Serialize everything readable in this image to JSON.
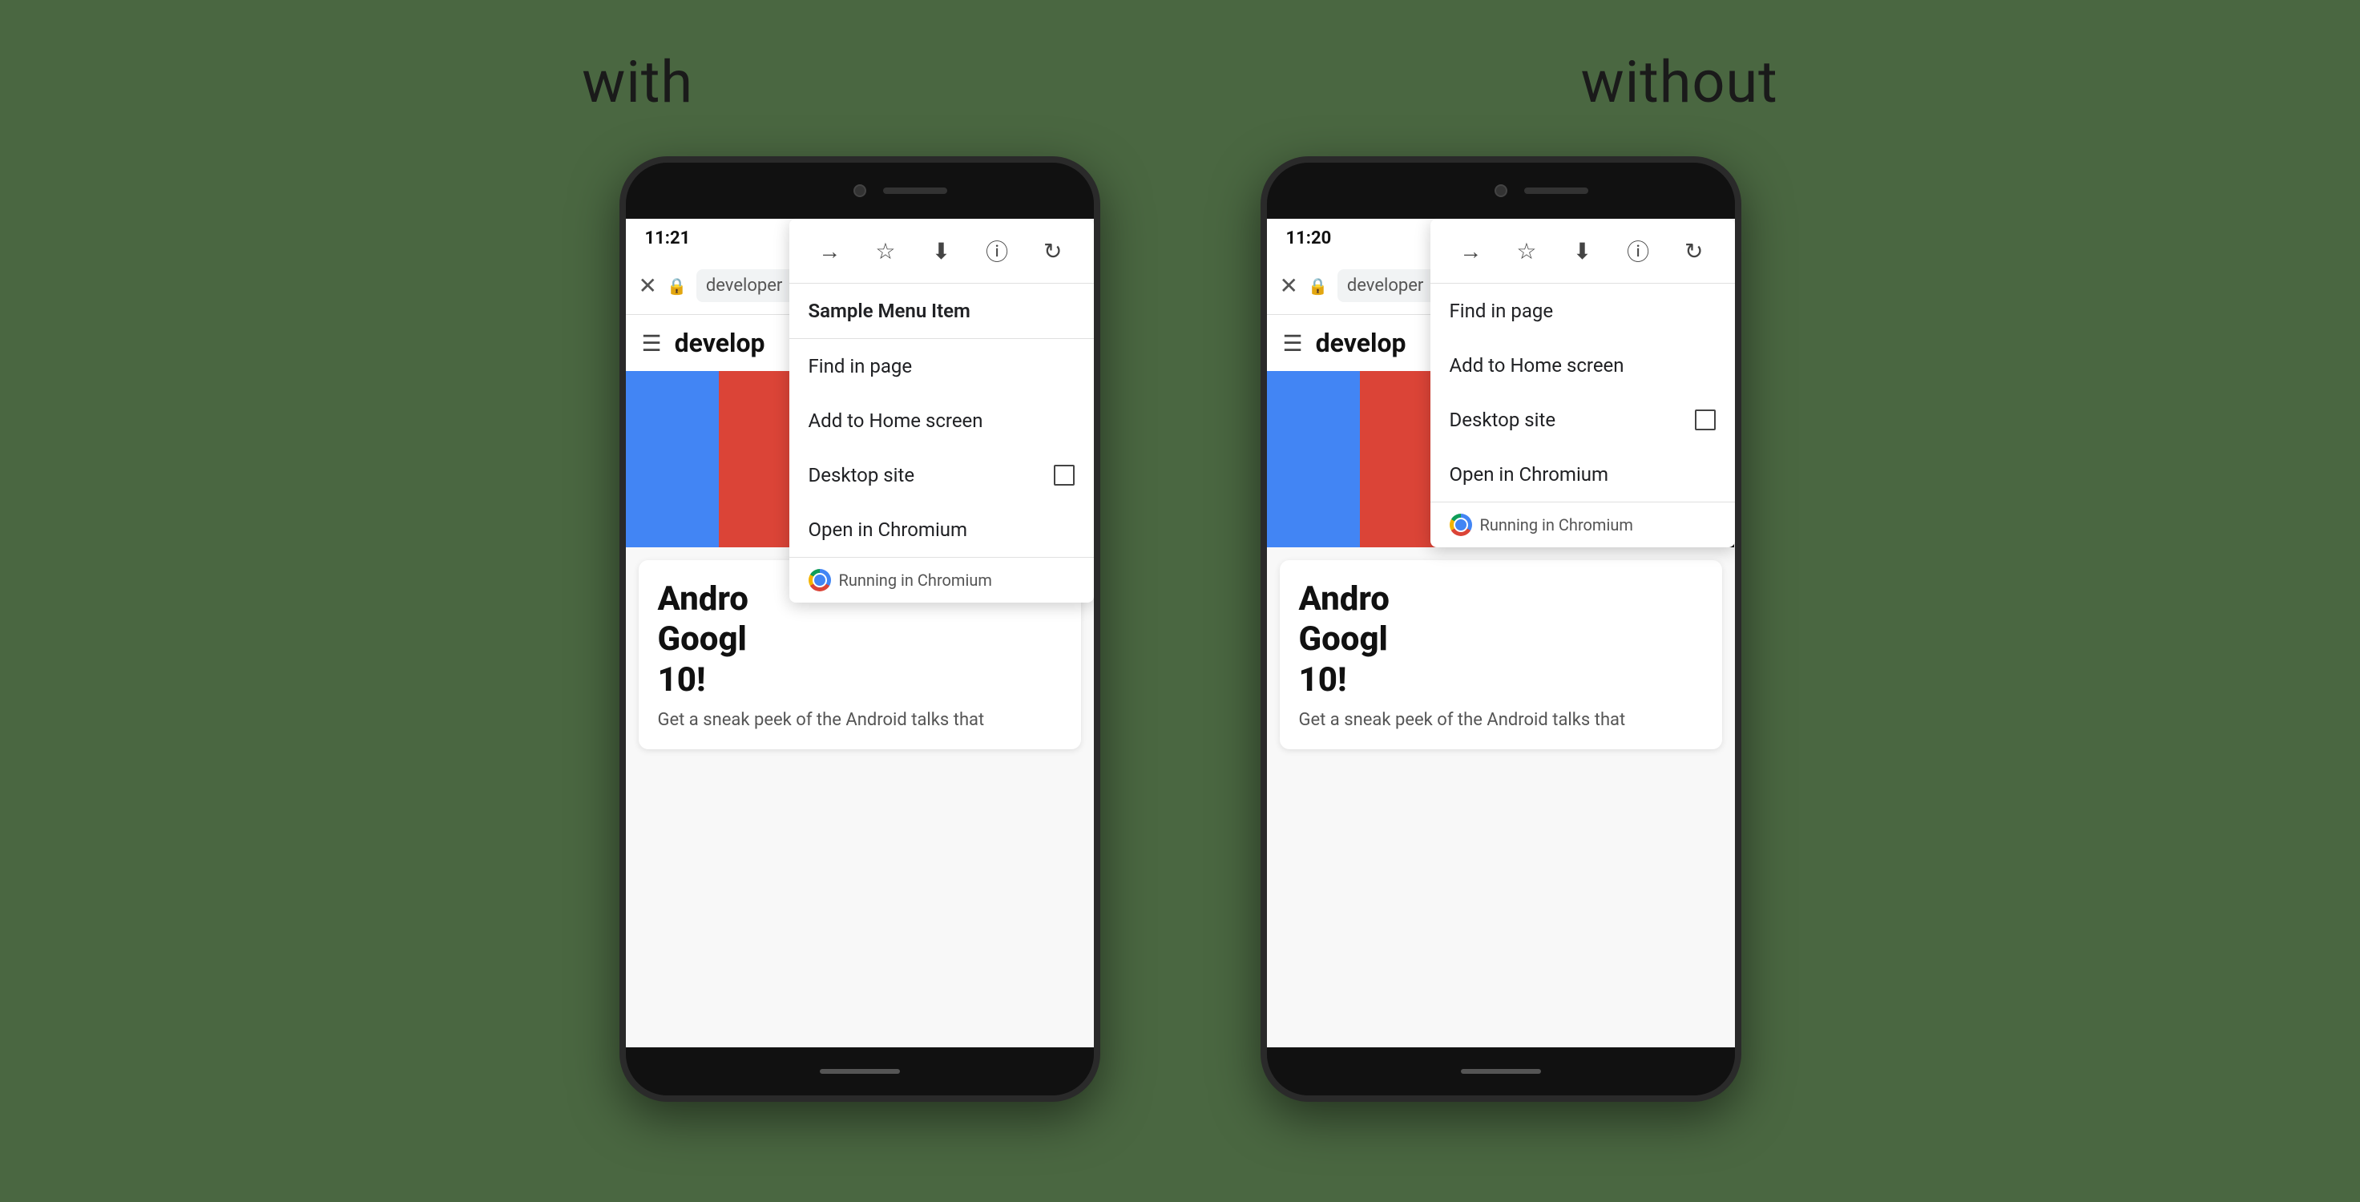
{
  "labels": {
    "with": "with",
    "without": "without"
  },
  "phone_with": {
    "time": "11:21",
    "url": "developer",
    "page_title": "develop",
    "article_heading_line1": "Andro",
    "article_heading_line2": "Googl",
    "article_heading_line3": "10!",
    "article_sub": "Get a sneak peek of the Android talks that",
    "menu": {
      "sample_item": "Sample Menu Item",
      "find_in_page": "Find in page",
      "add_to_home": "Add to Home screen",
      "desktop_site": "Desktop site",
      "open_in_chromium": "Open in Chromium",
      "running_in": "Running in Chromium"
    }
  },
  "phone_without": {
    "time": "11:20",
    "url": "developer",
    "page_title": "develop",
    "article_heading_line1": "Andro",
    "article_heading_line2": "Googl",
    "article_heading_line3": "10!",
    "article_sub": "Get a sneak peek of the Android talks that",
    "menu": {
      "find_in_page": "Find in page",
      "add_to_home": "Add to Home screen",
      "desktop_site": "Desktop site",
      "open_in_chromium": "Open in Chromium",
      "running_in": "Running in Chromium"
    }
  },
  "icons": {
    "close": "✕",
    "lock": "🔒",
    "forward": "→",
    "star": "☆",
    "download": "⬇",
    "info": "ⓘ",
    "reload": "↻",
    "hamburger": "☰"
  }
}
